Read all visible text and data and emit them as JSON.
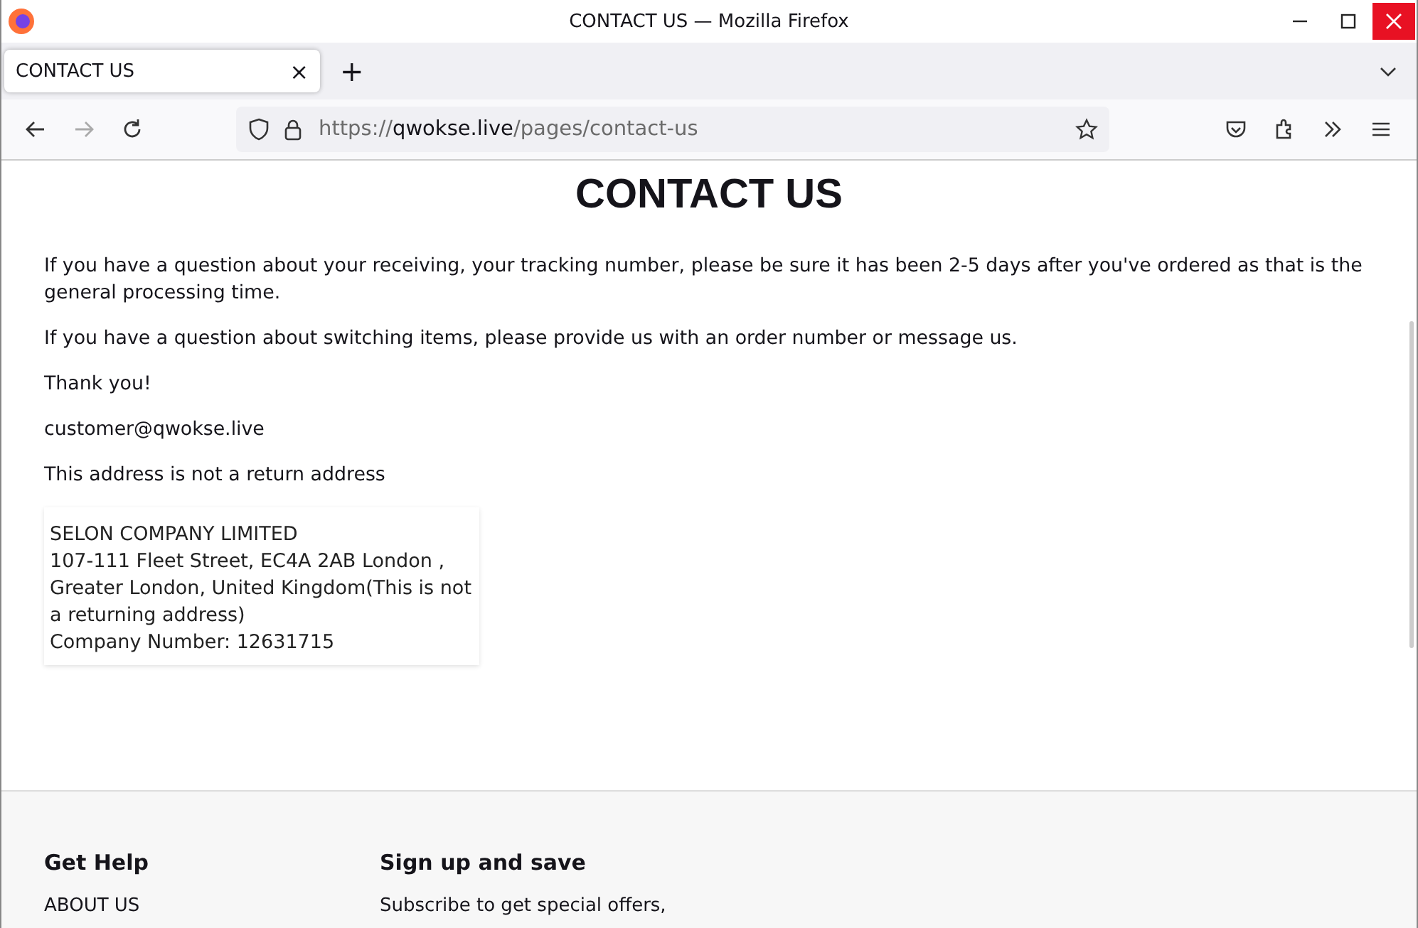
{
  "window": {
    "title": "CONTACT US — Mozilla Firefox"
  },
  "tabs": [
    {
      "label": "CONTACT US",
      "selected": true,
      "close": "×"
    }
  ],
  "new_tab": "+",
  "url": {
    "scheme": "https://",
    "host": "qwokse.live",
    "path": "/pages/contact-us"
  },
  "page": {
    "heading": "CONTACT US",
    "paragraphs": [
      "If you have a question about your receiving, your tracking number, please be sure it has been 2-5 days after you've ordered as that is the general processing time.",
      "If you have a question about switching items, please provide us with an order number or message us.",
      "Thank you!",
      "customer@qwokse.live",
      "This address is not a return address"
    ],
    "address": [
      "SELON COMPANY LIMITED",
      "107-111 Fleet Street, EC4A 2AB London , Greater London, United Kingdom(This is not a returning address)",
      "Company Number: 12631715"
    ]
  },
  "footer": {
    "columns": [
      {
        "heading": "Get Help",
        "items": [
          "ABOUT US"
        ]
      },
      {
        "heading": "Sign up and save",
        "items": [
          "Subscribe to get special offers,"
        ]
      }
    ]
  }
}
